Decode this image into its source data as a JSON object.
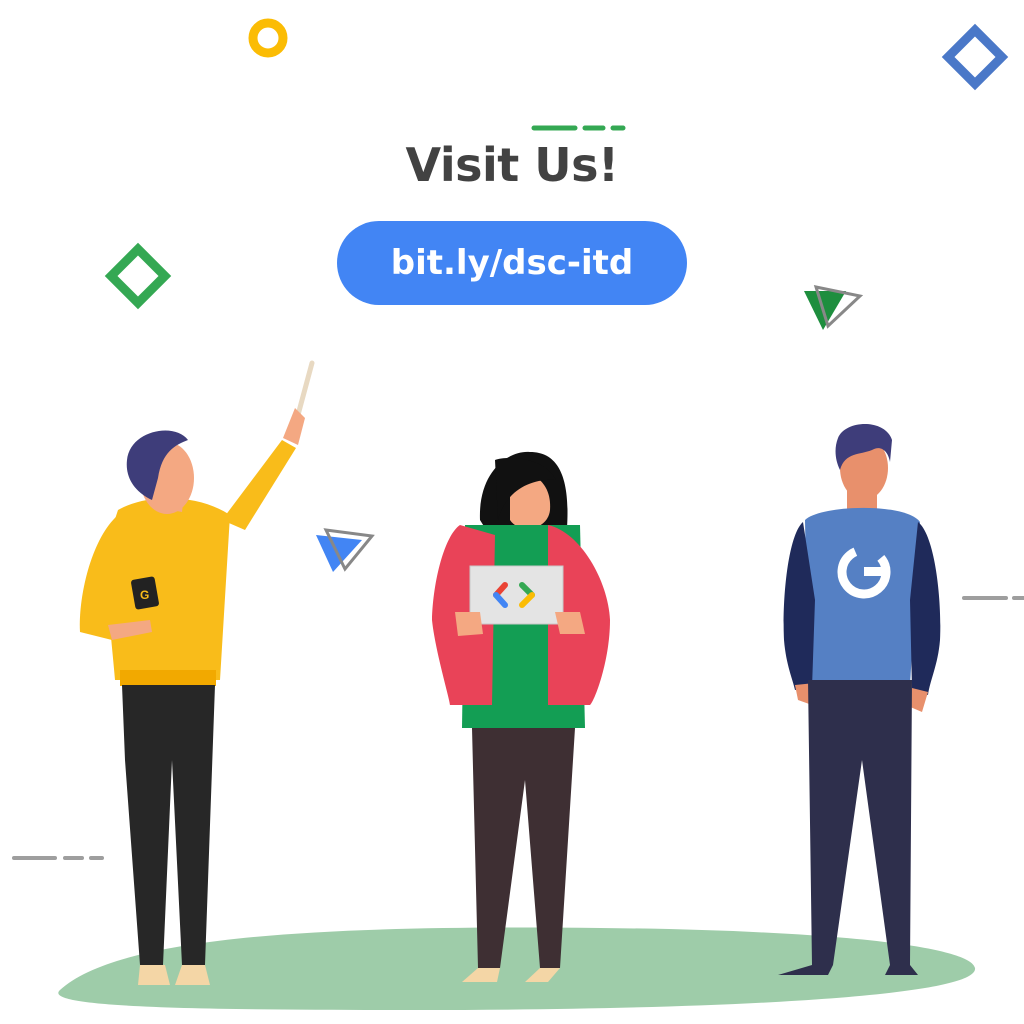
{
  "heading": "Visit Us!",
  "link": {
    "label": "bit.ly/dsc-itd"
  },
  "hoodie_logo_letter": "G",
  "colors": {
    "google_blue": "#4285F4",
    "google_red": "#EA4335",
    "google_yellow": "#FBBC04",
    "google_green": "#34A853",
    "heading_text": "#424242",
    "ground": "#9ECCA9"
  },
  "icons": [
    "ring-icon",
    "diamond-icon",
    "triangle-icon",
    "dash-line-icon",
    "code-brackets-icon",
    "google-g-icon"
  ]
}
